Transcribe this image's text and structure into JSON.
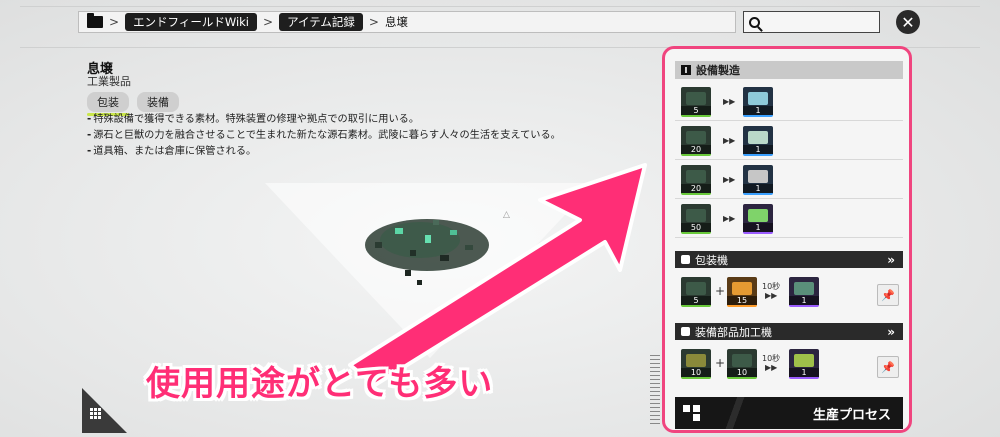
{
  "breadcrumb": {
    "items": [
      "エンドフィールドWiki",
      "アイテム記録"
    ],
    "current": "息壌"
  },
  "search": {
    "placeholder": ""
  },
  "item": {
    "name": "息壌",
    "category": "工業製品",
    "tabs": [
      "包装",
      "装備"
    ],
    "description": [
      "特殊設備で獲得できる素材。特殊装置の修理や拠点での取引に用いる。",
      "源石と巨獣の力を融合させることで生まれた新たな源石素材。武陵に暮らす人々の生活を支えている。",
      "道具箱、または倉庫に保管される。"
    ]
  },
  "overlay": {
    "caption": "使用用途がとても多い"
  },
  "panel": {
    "title": "設備製造",
    "recipes": [
      {
        "input_qty": "5",
        "output_qty": "1",
        "output_color": "blue"
      },
      {
        "input_qty": "20",
        "output_qty": "1",
        "output_color": "blue"
      },
      {
        "input_qty": "20",
        "output_qty": "1",
        "output_color": "blue"
      },
      {
        "input_qty": "50",
        "output_qty": "1",
        "output_color": "purple"
      }
    ],
    "packager": {
      "title": "包装機",
      "inputs": [
        "5",
        "15"
      ],
      "time": "10秒",
      "output_qty": "1"
    },
    "parts": {
      "title": "装備部品加工機",
      "inputs": [
        "10",
        "10"
      ],
      "time": "10秒",
      "output_qty": "1"
    },
    "production_label": "生産プロセス"
  },
  "colors": {
    "accent": "#f0457f",
    "caption": "#ff2e76"
  }
}
